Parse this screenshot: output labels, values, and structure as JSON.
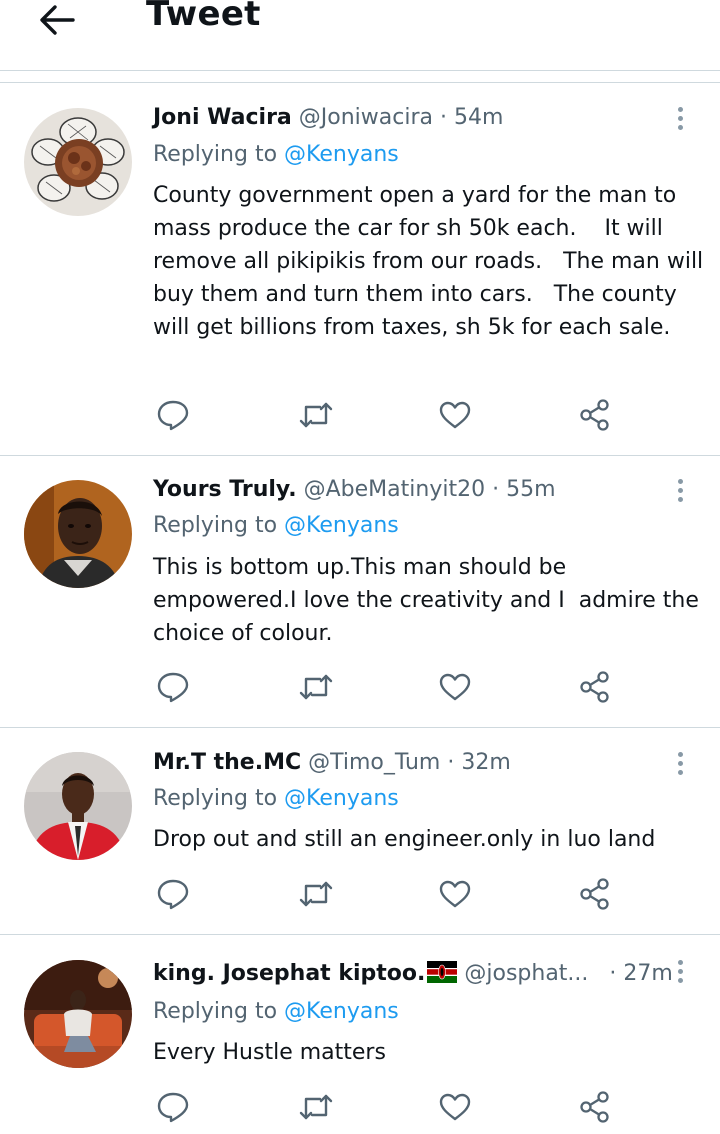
{
  "header": {
    "title": "Tweet",
    "back_icon": "arrow-left-icon"
  },
  "colors": {
    "text": "#0f1419",
    "secondary": "#536471",
    "link": "#1d9bf0",
    "divider": "#cfd9de"
  },
  "tweets": [
    {
      "name": "Joni Wacira",
      "handle": "@Joniwacira",
      "sep": "·",
      "time": "54m",
      "replying_prefix": "Replying to ",
      "replying_to": "@Kenyans",
      "text": "County government open a yard for the man to mass produce the car for sh 50k each.    It will remove all pikipikis from our roads.   The man will buy them and turn them into cars.   The county will get billions from taxes, sh 5k for each sale.",
      "avatar": "flower-avatar"
    },
    {
      "name": "Yours Truly.",
      "handle": "@AbeMatinyit20",
      "sep": "·",
      "time": "55m",
      "replying_prefix": "Replying to ",
      "replying_to": "@Kenyans",
      "text": "This is bottom up.This man should be empowered.I love the creativity and I  admire the choice of colour.",
      "avatar": "man-portrait-avatar"
    },
    {
      "name": "Mr.T the.MC",
      "handle": "@Timo_Tum",
      "sep": "·",
      "time": "32m",
      "replying_prefix": "Replying to ",
      "replying_to": "@Kenyans",
      "text": "Drop out and still an engineer.only in luo land",
      "avatar": "red-suit-avatar"
    },
    {
      "name": "king. Josephat kiptoo.",
      "handle": "@josphat...",
      "sep": "·",
      "time": "27m",
      "replying_prefix": "Replying to ",
      "replying_to": "@Kenyans",
      "text": "Every Hustle matters",
      "avatar": "seated-man-avatar",
      "flag": "kenya-flag-icon"
    }
  ],
  "action_icons": [
    "reply-icon",
    "retweet-icon",
    "like-icon",
    "share-icon"
  ]
}
